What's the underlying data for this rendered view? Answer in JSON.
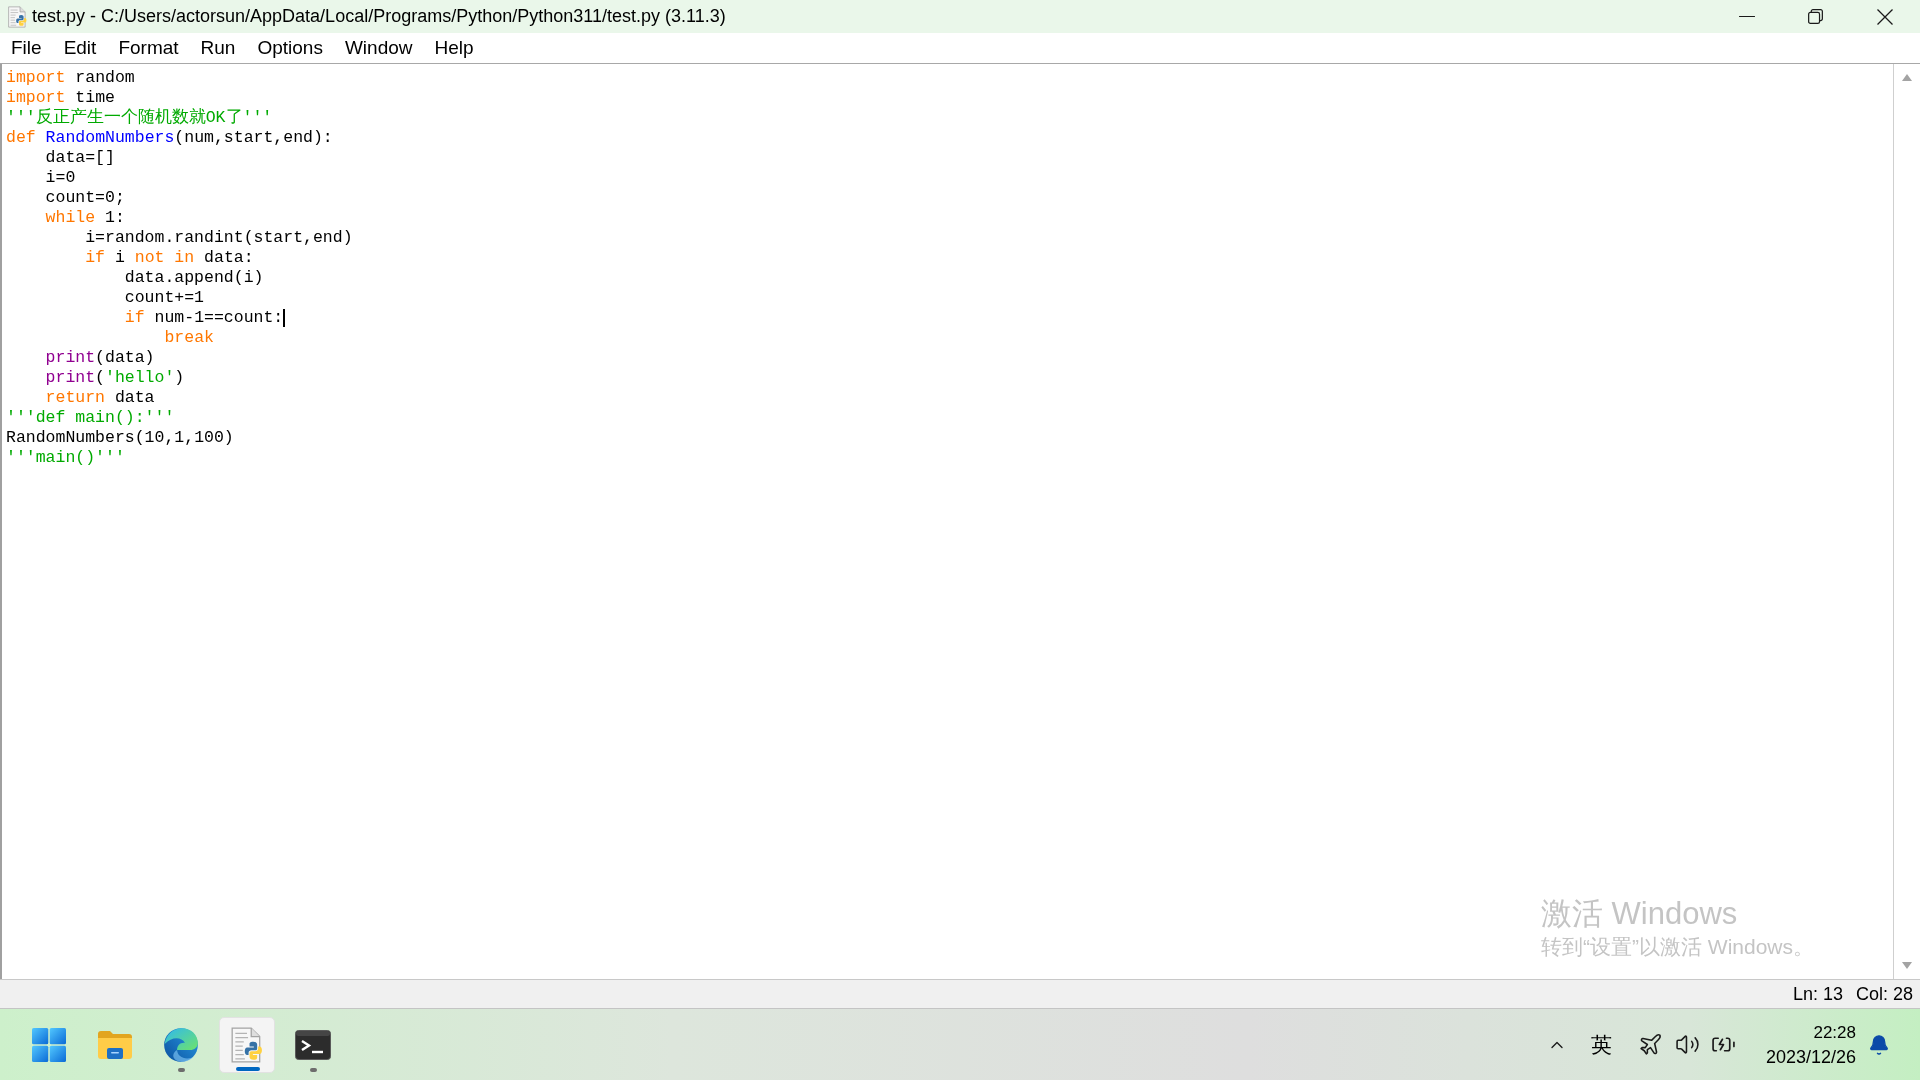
{
  "window": {
    "title": "test.py - C:/Users/actorsun/AppData/Local/Programs/Python/Python311/test.py (3.11.3)"
  },
  "menu": [
    "File",
    "Edit",
    "Format",
    "Run",
    "Options",
    "Window",
    "Help"
  ],
  "editor": {
    "lines": [
      {
        "cursor": false,
        "segments": [
          {
            "kind": "keyword",
            "text": "import"
          },
          {
            "kind": "plain",
            "text": " random"
          }
        ]
      },
      {
        "cursor": false,
        "segments": [
          {
            "kind": "keyword",
            "text": "import"
          },
          {
            "kind": "plain",
            "text": " time"
          }
        ]
      },
      {
        "cursor": false,
        "segments": [
          {
            "kind": "string",
            "text": "'''反正产生一个随机数就OK了'''"
          }
        ]
      },
      {
        "cursor": false,
        "segments": [
          {
            "kind": "keyword",
            "text": "def"
          },
          {
            "kind": "definition",
            "text": " RandomNumbers"
          },
          {
            "kind": "plain",
            "text": "(num,start,end):"
          }
        ],
        "children": [
          {
            "cursor": false,
            "segments": [
              {
                "kind": "plain",
                "text": "data=[]"
              }
            ]
          },
          {
            "cursor": false,
            "segments": [
              {
                "kind": "plain",
                "text": "i=0"
              }
            ]
          },
          {
            "cursor": false,
            "segments": [
              {
                "kind": "plain",
                "text": "count=0;"
              }
            ]
          },
          {
            "cursor": false,
            "segments": [
              {
                "kind": "keyword",
                "text": "while"
              },
              {
                "kind": "plain",
                "text": " 1:"
              }
            ],
            "children": [
              {
                "cursor": false,
                "segments": [
                  {
                    "kind": "plain",
                    "text": "i=random.randint(start,end)"
                  }
                ]
              },
              {
                "cursor": false,
                "segments": [
                  {
                    "kind": "keyword",
                    "text": "if"
                  },
                  {
                    "kind": "plain",
                    "text": " i "
                  },
                  {
                    "kind": "keyword",
                    "text": "not"
                  },
                  {
                    "kind": "keyword",
                    "text": " in"
                  },
                  {
                    "kind": "plain",
                    "text": " data:"
                  }
                ],
                "children": [
                  {
                    "cursor": false,
                    "segments": [
                      {
                        "kind": "plain",
                        "text": "data.append(i)"
                      }
                    ]
                  },
                  {
                    "cursor": false,
                    "segments": [
                      {
                        "kind": "plain",
                        "text": "count+=1"
                      }
                    ]
                  },
                  {
                    "cursor": true,
                    "segments": [
                      {
                        "kind": "keyword",
                        "text": "if"
                      },
                      {
                        "kind": "plain",
                        "text": " num-1==count:"
                      }
                    ],
                    "children": [
                      {
                        "cursor": false,
                        "segments": [
                          {
                            "kind": "keyword",
                            "text": "break"
                          }
                        ]
                      }
                    ]
                  }
                ]
              }
            ]
          },
          {
            "cursor": false,
            "segments": [
              {
                "kind": "builtin",
                "text": "print"
              },
              {
                "kind": "plain",
                "text": "(data)"
              }
            ]
          },
          {
            "cursor": false,
            "segments": [
              {
                "kind": "builtin",
                "text": "print"
              },
              {
                "kind": "plain",
                "text": "("
              },
              {
                "kind": "string",
                "text": "'hello'"
              },
              {
                "kind": "plain",
                "text": ")"
              }
            ]
          },
          {
            "cursor": false,
            "segments": [
              {
                "kind": "keyword",
                "text": "return"
              },
              {
                "kind": "plain",
                "text": " data"
              }
            ]
          }
        ]
      },
      {
        "cursor": false,
        "segments": [
          {
            "kind": "string",
            "text": "'''def main():'''"
          }
        ]
      },
      {
        "cursor": false,
        "segments": [
          {
            "kind": "plain",
            "text": "RandomNumbers(10,1,100)"
          }
        ]
      },
      {
        "cursor": false,
        "segments": [
          {
            "kind": "string",
            "text": "'''main()'''"
          }
        ]
      }
    ]
  },
  "status_bar": {
    "line": "Ln: 13",
    "column": "Col: 28"
  },
  "activation_notice": {
    "title": "激活 Windows",
    "message": "转到“设置”以激活 Windows。"
  },
  "taskbar": {
    "apps": [
      {
        "kind": "start",
        "running": false,
        "selected": false
      },
      {
        "kind": "folder",
        "running": false,
        "selected": false
      },
      {
        "kind": "browser",
        "running": true,
        "selected": false
      },
      {
        "kind": "python-editor",
        "running": true,
        "selected": true
      },
      {
        "kind": "terminal",
        "running": true,
        "selected": false
      }
    ],
    "input_method": "英",
    "clock": {
      "time": "22:28",
      "date": "2023/12/26"
    }
  }
}
